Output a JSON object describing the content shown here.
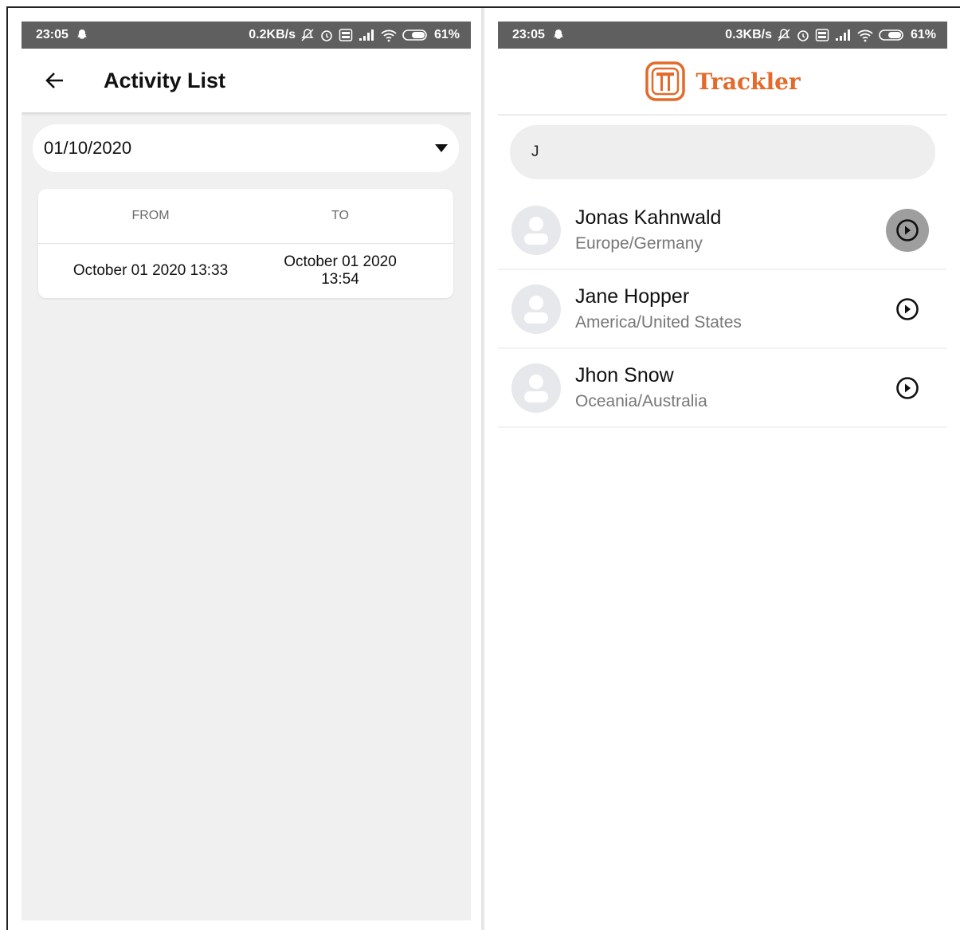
{
  "left_screen": {
    "status_bar": {
      "time": "23:05",
      "net_speed": "0.2KB/s",
      "battery": "61%"
    },
    "app_bar": {
      "title": "Activity List"
    },
    "date_select": {
      "value": "01/10/2020"
    },
    "time_table": {
      "headers": [
        "FROM",
        "TO"
      ],
      "rows": [
        {
          "from": "October 01 2020 13:33",
          "to": "October 01 2020 13:54"
        }
      ]
    }
  },
  "right_screen": {
    "status_bar": {
      "time": "23:05",
      "net_speed": "0.3KB/s",
      "battery": "61%"
    },
    "brand": {
      "name": "Trackler",
      "color": "#e36a2a"
    },
    "search": {
      "value": "J"
    },
    "people": [
      {
        "name": "Jonas Kahnwald",
        "region": "Europe/Germany"
      },
      {
        "name": "Jane Hopper",
        "region": "America/United States"
      },
      {
        "name": "Jhon Snow",
        "region": "Oceania/Australia"
      }
    ]
  }
}
